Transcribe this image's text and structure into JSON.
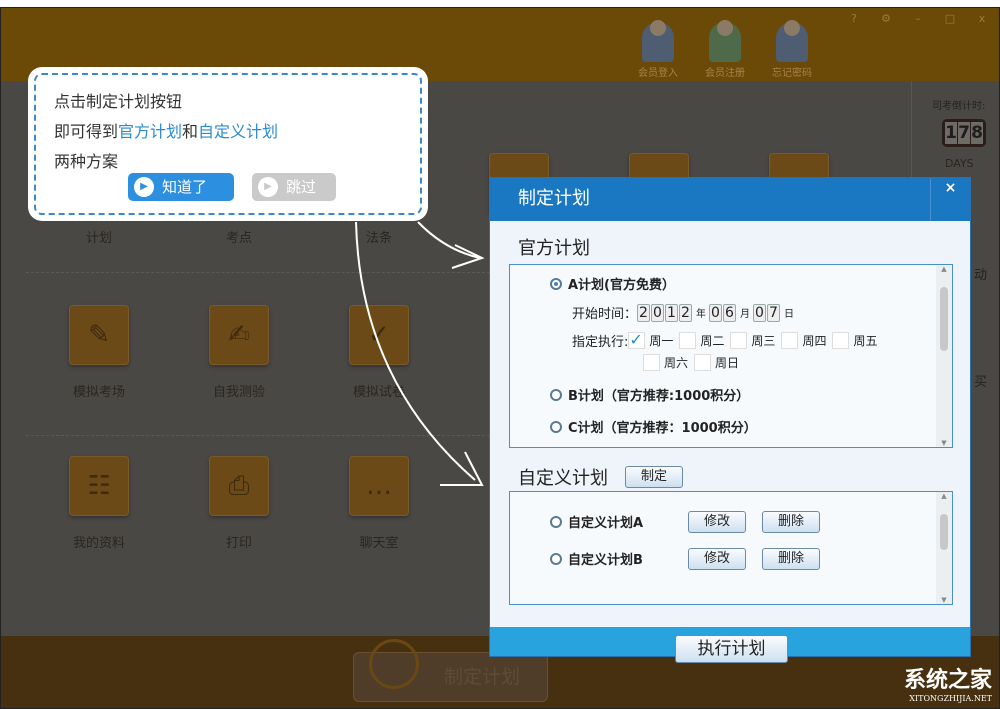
{
  "window": {
    "controls": [
      "?",
      "⚙",
      "–",
      "□",
      "x"
    ]
  },
  "account": [
    {
      "label": "会员登入"
    },
    {
      "label": "会员注册"
    },
    {
      "label": "忘记密码"
    }
  ],
  "tiles": [
    {
      "label": "计划",
      "icon": "plan-icon"
    },
    {
      "label": "考点",
      "icon": "pencil-icon"
    },
    {
      "label": "法条",
      "icon": "law-icon"
    },
    {
      "label": "模拟考场",
      "icon": "blackboard-icon"
    },
    {
      "label": "自我测验",
      "icon": "test-icon"
    },
    {
      "label": "模拟试卷",
      "icon": "paper-icon"
    },
    {
      "label": "我的资料",
      "icon": "profile-icon"
    },
    {
      "label": "打印",
      "icon": "printer-icon"
    },
    {
      "label": "聊天室",
      "icon": "chat-icon"
    }
  ],
  "sidebar": {
    "countdown_label": "司考倒计时:",
    "digits": [
      "1",
      "7",
      "8"
    ],
    "days": "DAYS",
    "partial1": "动",
    "partial2": "买"
  },
  "bottom": {
    "plan_button": "制定计划"
  },
  "tooltip": {
    "line1": "点击制定计划按钮",
    "line2_a": "即可得到",
    "line2_b": "官方计划",
    "line2_c": "和",
    "line2_d": "自定义计划",
    "line3": "两种方案",
    "ok": "知道了",
    "skip": "跳过",
    "accent": "#2c8fe0"
  },
  "dialog": {
    "title": "制定计划",
    "close": "×",
    "official": {
      "heading": "官方计划",
      "plan_a": "A计划(官方免费）",
      "start_label": "开始时间：",
      "year": [
        "2",
        "0",
        "1",
        "2"
      ],
      "year_unit": "年",
      "month": [
        "0",
        "6"
      ],
      "month_unit": "月",
      "day": [
        "0",
        "7"
      ],
      "day_unit": "日",
      "exec_label": "指定执行:",
      "days": [
        {
          "label": "周一",
          "checked": true
        },
        {
          "label": "周二",
          "checked": false
        },
        {
          "label": "周三",
          "checked": false
        },
        {
          "label": "周四",
          "checked": false
        },
        {
          "label": "周五",
          "checked": false
        },
        {
          "label": "周六",
          "checked": false
        },
        {
          "label": "周日",
          "checked": false
        }
      ],
      "plan_b": "B计划（官方推荐:1000积分）",
      "plan_c": "C计划（官方推荐：1000积分）",
      "selected": "A"
    },
    "custom": {
      "heading": "自定义计划",
      "create": "制定",
      "items": [
        {
          "label": "自定义计划A",
          "edit": "修改",
          "delete": "删除"
        },
        {
          "label": "自定义计划B",
          "edit": "修改",
          "delete": "删除"
        }
      ]
    },
    "execute": "执行计划",
    "header_color": "#1a78c2",
    "footer_color": "#29a3dd"
  },
  "watermark": {
    "name": "系统之家",
    "url": "XITONGZHIJIA.NET"
  }
}
